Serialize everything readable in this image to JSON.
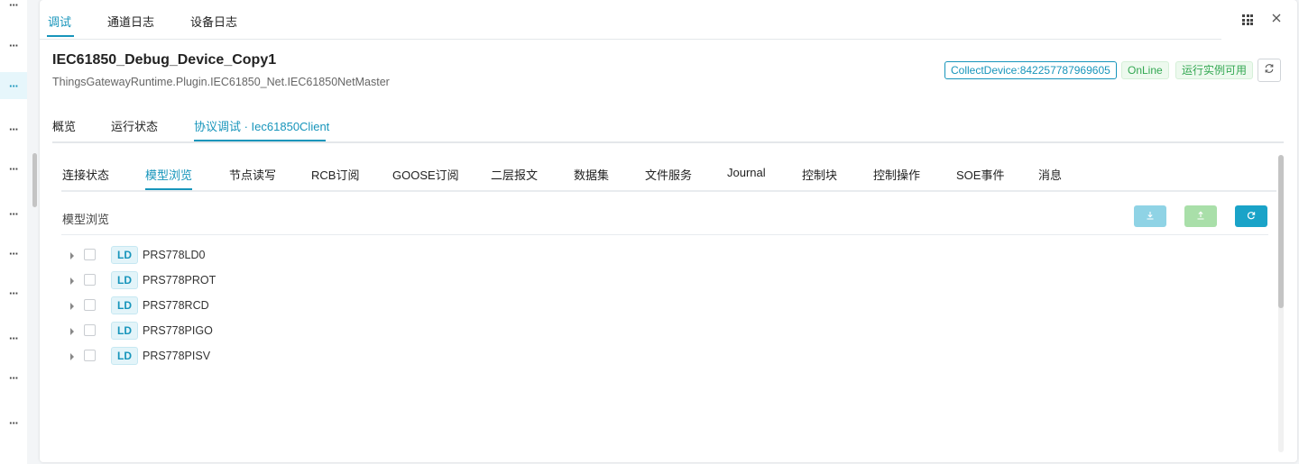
{
  "sidebar": {
    "dots": [
      "···",
      "···",
      "···",
      "···",
      "···",
      "···",
      "···",
      "···",
      "···",
      "···",
      "···"
    ]
  },
  "top_tabs": [
    "调试",
    "通道日志",
    "设备日志"
  ],
  "device": {
    "title": "IEC61850_Debug_Device_Copy1",
    "subtitle": "ThingsGatewayRuntime.Plugin.IEC61850_Net.IEC61850NetMaster",
    "badge_collect": "CollectDevice:842257787969605",
    "badge_online": "OnLine",
    "badge_status": "运行实例可用"
  },
  "section_tabs": [
    "概览",
    "运行状态",
    "协议调试 · Iec61850Client"
  ],
  "sub_tabs": [
    "连接状态",
    "模型浏览",
    "节点读写",
    "RCB订阅",
    "GOOSE订阅",
    "二层报文",
    "数据集",
    "文件服务",
    "Journal",
    "控制块",
    "控制操作",
    "SOE事件",
    "消息"
  ],
  "panel": {
    "title": "模型浏览"
  },
  "tree": [
    {
      "tag": "LD",
      "label": "PRS778LD0"
    },
    {
      "tag": "LD",
      "label": "PRS778PROT"
    },
    {
      "tag": "LD",
      "label": "PRS778RCD"
    },
    {
      "tag": "LD",
      "label": "PRS778PIGO"
    },
    {
      "tag": "LD",
      "label": "PRS778PISV"
    }
  ],
  "colors": {
    "accent": "#1795bb",
    "success": "#33a852",
    "download_btn": "#8fd3e5",
    "upload_btn": "#a9dfa9",
    "reload_btn": "#1aa3c8"
  },
  "icons": {
    "grid": "grid-icon",
    "close": "close-icon",
    "refresh": "refresh-icon",
    "download": "download-icon",
    "upload": "upload-icon",
    "reload": "reload-icon"
  }
}
